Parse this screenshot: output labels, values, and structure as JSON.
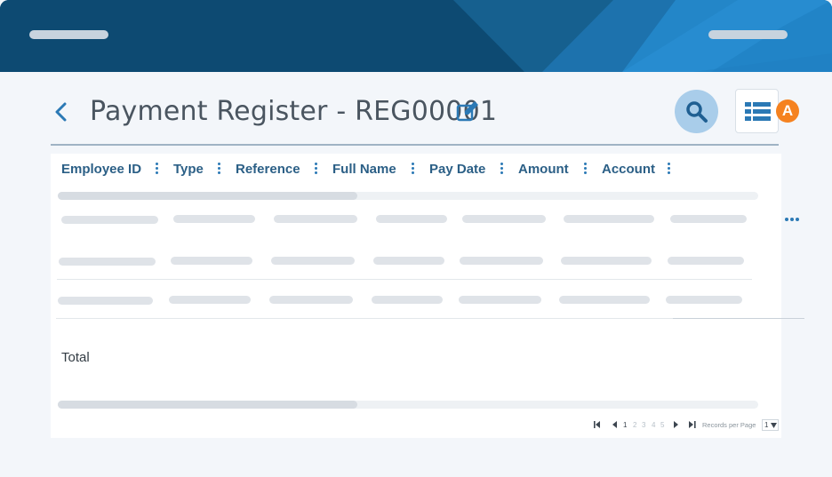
{
  "header": {
    "title": "Payment Register - REG00001"
  },
  "grid": {
    "columns": [
      {
        "label": "Employee ID"
      },
      {
        "label": "Type"
      },
      {
        "label": "Reference"
      },
      {
        "label": "Full Name"
      },
      {
        "label": "Pay Date"
      },
      {
        "label": "Amount"
      },
      {
        "label": "Account"
      }
    ],
    "total_label": "Total"
  },
  "toolbar": {
    "badge_letter": "A"
  },
  "pager": {
    "pages": [
      "1",
      "2",
      "3",
      "4",
      "5"
    ],
    "current_page": "1",
    "records_per_page_label": "Records per Page",
    "records_per_page_value": "1"
  },
  "colors": {
    "header_bg": "#0e4f7a",
    "accent": "#2b79b5",
    "badge": "#f58220",
    "column_text": "#2b5f86"
  },
  "icons": [
    "back-chevron-icon",
    "edit-icon",
    "search-icon",
    "list-view-icon",
    "more-horizontal-icon",
    "first-page-icon",
    "prev-page-icon",
    "next-page-icon",
    "last-page-icon",
    "dropdown-arrow-icon"
  ]
}
